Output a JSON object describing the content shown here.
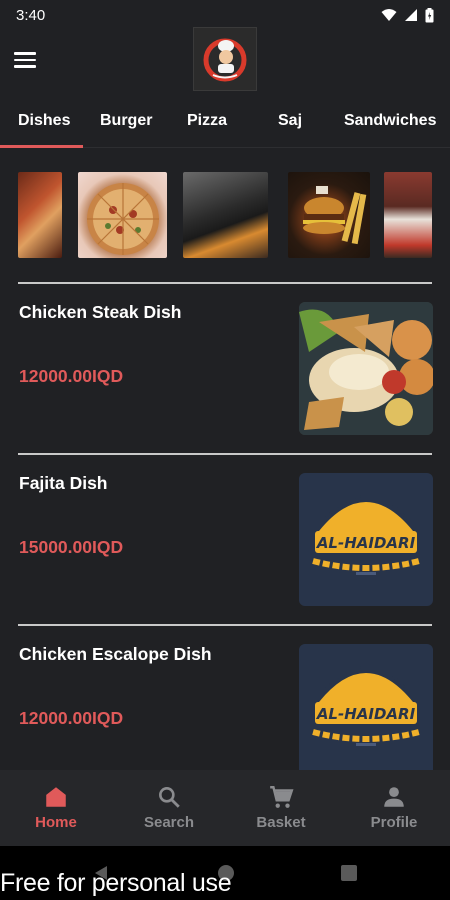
{
  "status": {
    "time": "3:40"
  },
  "tabs": [
    {
      "label": "Dishes",
      "active": true
    },
    {
      "label": "Burger"
    },
    {
      "label": "Pizza"
    },
    {
      "label": "Saj"
    },
    {
      "label": "Sandwiches"
    }
  ],
  "items": [
    {
      "name": "Chicken Steak Dish",
      "price": "12000.00IQD"
    },
    {
      "name": "Fajita Dish",
      "price": "15000.00IQD"
    },
    {
      "name": "Chicken Escalope Dish",
      "price": "12000.00IQD"
    }
  ],
  "placeholder_logo_text": "AL-HAIDARI",
  "bottom_nav": [
    {
      "label": "Home",
      "icon": "home-icon",
      "active": true
    },
    {
      "label": "Search",
      "icon": "search-icon"
    },
    {
      "label": "Basket",
      "icon": "cart-icon"
    },
    {
      "label": "Profile",
      "icon": "person-icon"
    }
  ],
  "watermark": "Free for personal use",
  "colors": {
    "accent": "#e05a5a",
    "background": "#202124",
    "nav_bg": "#26272a",
    "inactive": "#8a8b8e"
  }
}
